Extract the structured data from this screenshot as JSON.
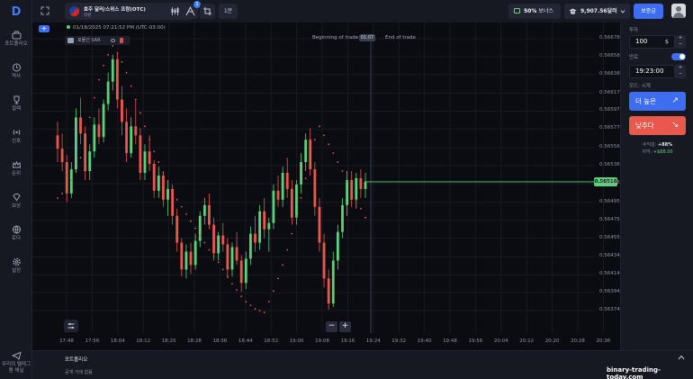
{
  "sidebar": {
    "items": [
      {
        "label": "포트폴리오",
        "icon": "briefcase-icon"
      },
      {
        "label": "역사",
        "icon": "history-icon"
      },
      {
        "label": "컬렉",
        "icon": "trophy-icon"
      },
      {
        "label": "신호",
        "icon": "signal-icon"
      },
      {
        "label": "순위",
        "icon": "crown-icon"
      },
      {
        "label": "보상",
        "icon": "diamond-icon"
      },
      {
        "label": "토다",
        "icon": "globe-icon"
      },
      {
        "label": "설정",
        "icon": "gear-icon"
      },
      {
        "label": "우리의 텔레그램 채널",
        "icon": "telegram-icon"
      }
    ]
  },
  "topbar": {
    "asset_name": "호주 달러/스위스 프랑(OTC)",
    "asset_type": "외환",
    "indicator_badge": "1",
    "timeframe": "1분",
    "bonus_percent": "50%",
    "bonus_label": "보너스",
    "balance": "9,907.56달러",
    "deposit_label": "보증금"
  },
  "chart": {
    "datetime": "01/18/2025 07:21:52 PM (UTC-03:00)",
    "indicator_name": "포물선 SAR",
    "beginning_label": "Beginning of trade",
    "end_label": "End of trade",
    "expiry_countdown": "01:07",
    "current_price": "0.56518",
    "colors": {
      "up": "#5bd27a",
      "down": "#e9584d",
      "sar": "#e9584d",
      "price_line": "#5bd27a"
    }
  },
  "chart_data": {
    "type": "candlestick",
    "y_ticks": [
      "0.56678",
      "0.56658",
      "0.56638",
      "0.56617",
      "0.56597",
      "0.56577",
      "0.56556",
      "0.56536",
      "0.56516",
      "0.56495",
      "0.56475",
      "0.56455",
      "0.56434",
      "0.56414",
      "0.56394",
      "0.56374"
    ],
    "x_ticks": [
      "17:48",
      "17:56",
      "18:04",
      "18:12",
      "18:20",
      "18:28",
      "18:36",
      "18:44",
      "18:52",
      "19:00",
      "19:08",
      "19:16",
      "19:24",
      "19:32",
      "19:40",
      "19:48",
      "19:56",
      "20:04",
      "20:12",
      "20:20",
      "20:28",
      "20:36"
    ],
    "ylim": [
      0.56364,
      0.56688
    ],
    "candles": [
      [
        0.5657,
        0.56585,
        0.5654,
        0.56555
      ],
      [
        0.56555,
        0.56572,
        0.5653,
        0.5654
      ],
      [
        0.5654,
        0.56548,
        0.56495,
        0.56505
      ],
      [
        0.56505,
        0.5654,
        0.565,
        0.56532
      ],
      [
        0.56532,
        0.566,
        0.56528,
        0.5659
      ],
      [
        0.5659,
        0.56612,
        0.5656,
        0.56572
      ],
      [
        0.56572,
        0.5658,
        0.5652,
        0.5653
      ],
      [
        0.5653,
        0.5656,
        0.5652,
        0.56552
      ],
      [
        0.56552,
        0.5659,
        0.56545,
        0.56582
      ],
      [
        0.56582,
        0.566,
        0.5656,
        0.56568
      ],
      [
        0.56568,
        0.5661,
        0.56562,
        0.56605
      ],
      [
        0.56605,
        0.5664,
        0.56598,
        0.5663
      ],
      [
        0.5663,
        0.5666,
        0.5662,
        0.56655
      ],
      [
        0.56655,
        0.56662,
        0.566,
        0.5661
      ],
      [
        0.5661,
        0.56625,
        0.5657,
        0.56585
      ],
      [
        0.56585,
        0.566,
        0.5654,
        0.5655
      ],
      [
        0.5655,
        0.5659,
        0.56545,
        0.5658
      ],
      [
        0.5658,
        0.5661,
        0.5656,
        0.5657
      ],
      [
        0.5657,
        0.56578,
        0.5652,
        0.56528
      ],
      [
        0.56528,
        0.5656,
        0.5652,
        0.56552
      ],
      [
        0.56552,
        0.5657,
        0.5653,
        0.56538
      ],
      [
        0.56538,
        0.56542,
        0.565,
        0.56508
      ],
      [
        0.56508,
        0.56535,
        0.565,
        0.56525
      ],
      [
        0.56525,
        0.5653,
        0.5649,
        0.56498
      ],
      [
        0.56498,
        0.5652,
        0.5648,
        0.5651
      ],
      [
        0.5651,
        0.56515,
        0.5647,
        0.5648
      ],
      [
        0.5648,
        0.56488,
        0.5644,
        0.5645
      ],
      [
        0.5645,
        0.56455,
        0.56412,
        0.5642
      ],
      [
        0.5642,
        0.56448,
        0.5641,
        0.5644
      ],
      [
        0.5644,
        0.5645,
        0.56415,
        0.56425
      ],
      [
        0.56425,
        0.5646,
        0.5642,
        0.56452
      ],
      [
        0.56452,
        0.56485,
        0.56445,
        0.5648
      ],
      [
        0.5648,
        0.565,
        0.5647,
        0.56492
      ],
      [
        0.56492,
        0.56505,
        0.56465,
        0.5647
      ],
      [
        0.5647,
        0.56478,
        0.5643,
        0.56438
      ],
      [
        0.56438,
        0.56462,
        0.5643,
        0.56458
      ],
      [
        0.56458,
        0.56472,
        0.5644,
        0.56448
      ],
      [
        0.56448,
        0.56455,
        0.5641,
        0.5642
      ],
      [
        0.5642,
        0.5645,
        0.56412,
        0.56445
      ],
      [
        0.56445,
        0.56462,
        0.56425,
        0.5643
      ],
      [
        0.5643,
        0.56436,
        0.56395,
        0.56405
      ],
      [
        0.56405,
        0.5644,
        0.56398,
        0.56432
      ],
      [
        0.56432,
        0.56468,
        0.56425,
        0.5646
      ],
      [
        0.5646,
        0.5648,
        0.5644,
        0.5645
      ],
      [
        0.5645,
        0.56492,
        0.56442,
        0.56485
      ],
      [
        0.56485,
        0.565,
        0.56455,
        0.56465
      ],
      [
        0.56465,
        0.56478,
        0.5644,
        0.56472
      ],
      [
        0.56472,
        0.56515,
        0.56465,
        0.56508
      ],
      [
        0.56508,
        0.56525,
        0.5649,
        0.56498
      ],
      [
        0.56498,
        0.56535,
        0.5649,
        0.56528
      ],
      [
        0.56528,
        0.56545,
        0.565,
        0.5651
      ],
      [
        0.5651,
        0.5652,
        0.5647,
        0.56478
      ],
      [
        0.56478,
        0.5652,
        0.5647,
        0.56515
      ],
      [
        0.56515,
        0.5655,
        0.56505,
        0.5654
      ],
      [
        0.5654,
        0.56572,
        0.5653,
        0.56565
      ],
      [
        0.56565,
        0.56578,
        0.56525,
        0.56532
      ],
      [
        0.56532,
        0.5654,
        0.5648,
        0.5649
      ],
      [
        0.5649,
        0.565,
        0.5644,
        0.5645
      ],
      [
        0.5645,
        0.5646,
        0.564,
        0.5641
      ],
      [
        0.5641,
        0.5642,
        0.56375,
        0.56382
      ],
      [
        0.56382,
        0.5644,
        0.56378,
        0.5643
      ],
      [
        0.5643,
        0.5647,
        0.5642,
        0.56462
      ],
      [
        0.56462,
        0.565,
        0.56455,
        0.56492
      ],
      [
        0.56492,
        0.5653,
        0.5648,
        0.5652
      ],
      [
        0.5652,
        0.5653,
        0.5649,
        0.56498
      ],
      [
        0.56498,
        0.56528,
        0.56488,
        0.56522
      ],
      [
        0.56522,
        0.56532,
        0.565,
        0.5651
      ],
      [
        0.5651,
        0.56528,
        0.565,
        0.56518
      ]
    ],
    "sar_dots": [
      [
        0.565
      ],
      [
        0.56505
      ],
      [
        0.56512
      ],
      [
        0.5652
      ],
      [
        0.5653
      ],
      [
        0.56545
      ],
      [
        0.56565
      ],
      [
        0.5659
      ],
      [
        0.56612
      ],
      [
        0.56632
      ],
      [
        0.56648
      ],
      [
        0.5666
      ],
      [
        0.5667
      ],
      [
        0.56662
      ],
      [
        0.56652
      ],
      [
        0.5664
      ],
      [
        0.56625
      ],
      [
        0.5661
      ],
      [
        0.56595
      ],
      [
        0.5658
      ],
      [
        0.56565
      ],
      [
        0.56552
      ],
      [
        0.5654
      ],
      [
        0.56528
      ],
      [
        0.56518
      ],
      [
        0.56508
      ],
      [
        0.56498
      ],
      [
        0.5649
      ],
      [
        0.56482
      ],
      [
        0.56474
      ],
      [
        0.56466
      ],
      [
        0.56458
      ],
      [
        0.5645
      ],
      [
        0.56442
      ],
      [
        0.56435
      ],
      [
        0.56428
      ],
      [
        0.5642
      ],
      [
        0.56412
      ],
      [
        0.56404
      ],
      [
        0.56397
      ],
      [
        0.5639
      ],
      [
        0.56384
      ],
      [
        0.5638
      ],
      [
        0.56376
      ],
      [
        0.56374
      ],
      [
        0.56372
      ],
      [
        0.56384
      ],
      [
        0.56396
      ],
      [
        0.5641
      ],
      [
        0.56425
      ],
      [
        0.56442
      ],
      [
        0.5646
      ],
      [
        0.5648
      ],
      [
        0.565
      ],
      [
        0.56522
      ],
      [
        0.56545
      ],
      [
        0.56565
      ],
      [
        0.5658
      ],
      [
        0.5657
      ],
      [
        0.5656
      ],
      [
        0.5655
      ],
      [
        0.5654
      ],
      [
        0.5653
      ],
      [
        0.56518
      ],
      [
        0.56508
      ],
      [
        0.56498
      ],
      [
        0.56488
      ],
      [
        0.56478
      ]
    ]
  },
  "panel": {
    "amount_label": "투자",
    "amount_value": "100",
    "amount_currency": "$",
    "expiry_label": "만료",
    "expiry_value": "19:23:00",
    "mode_label": "모드: 시계",
    "call_label": "더 높은",
    "put_label": "낮추다",
    "payout_label": "수익성:",
    "payout_value": "+88%",
    "profit_label": "이익:",
    "profit_value": "+$88.00"
  },
  "bottom": {
    "tab_label": "포트폴리오",
    "sub_label": "공개 거래 없음",
    "watermark": "binary-trading-today.com"
  }
}
